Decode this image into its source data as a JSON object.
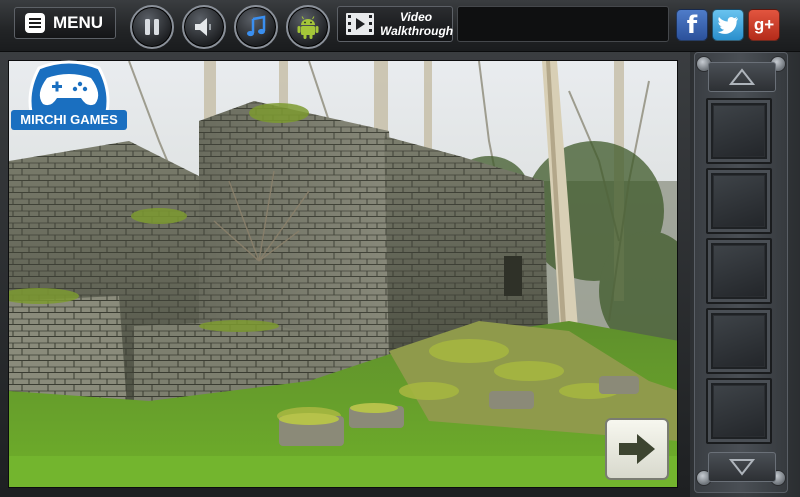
{
  "toolbar": {
    "menu_label": "MENU",
    "walkthrough_line1": "Video",
    "walkthrough_line2": "Walkthrough",
    "buttons": [
      "pause-icon",
      "speaker-icon",
      "music-note-icon",
      "android-icon"
    ],
    "social": {
      "facebook": "f",
      "google_plus": "g+"
    }
  },
  "logo": {
    "text": "MIRCHI GAMES",
    "icon": "gamepad-icon"
  },
  "scene": {
    "next_icon": "arrow-right-icon"
  },
  "inventory": {
    "up_icon": "triangle-up-icon",
    "down_icon": "triangle-down-icon",
    "slot_count": 5
  },
  "colors": {
    "facebook": "#3b5998",
    "twitter": "#3aa3e3",
    "google_plus": "#d0422a",
    "logo_blue": "#1a6fc0"
  }
}
